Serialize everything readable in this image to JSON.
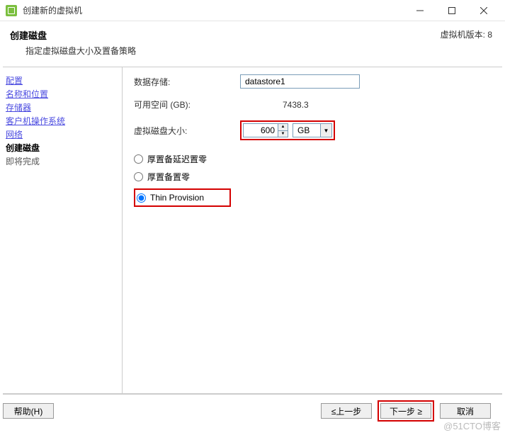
{
  "window": {
    "title": "创建新的虚拟机",
    "min": "–",
    "max": "☐",
    "close": "✕"
  },
  "header": {
    "title": "创建磁盘",
    "subtitle": "指定虚拟磁盘大小及置备策略"
  },
  "version": "虚拟机版本: 8",
  "sidebar": {
    "items": [
      {
        "label": "配置",
        "state": "link"
      },
      {
        "label": "名称和位置",
        "state": "link"
      },
      {
        "label": "存储器",
        "state": "link"
      },
      {
        "label": "客户机操作系统",
        "state": "link"
      },
      {
        "label": "网络",
        "state": "link"
      },
      {
        "label": "创建磁盘",
        "state": "current"
      },
      {
        "label": "即将完成",
        "state": "pending"
      }
    ]
  },
  "main": {
    "datastore_label": "数据存储:",
    "datastore_value": "datastore1",
    "space_label": "可用空间 (GB):",
    "space_value": "7438.3",
    "disksize_label": "虚拟磁盘大小:",
    "disksize_value": "600",
    "disksize_unit": "GB",
    "radio": {
      "thick_lazy": "厚置备延迟置零",
      "thick_eager": "厚置备置零",
      "thin": "Thin Provision"
    }
  },
  "footer": {
    "help": "帮助(H)",
    "back": "≤上一步",
    "next": "下一步 ≥",
    "cancel": "取消"
  },
  "watermark": "@51CTO博客"
}
